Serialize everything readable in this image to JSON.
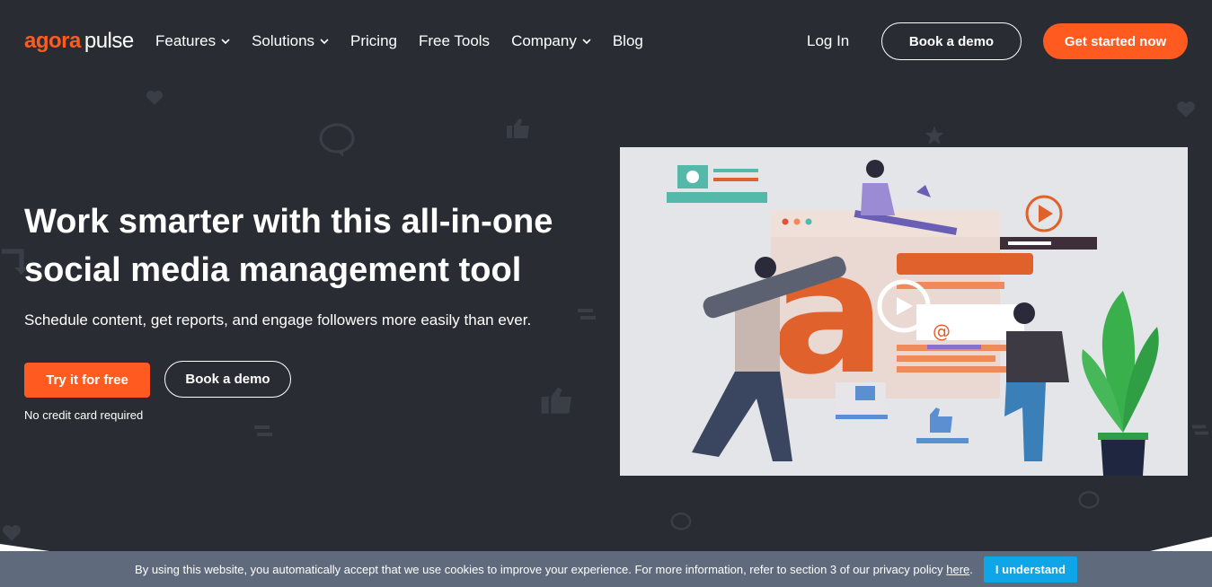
{
  "header": {
    "logo_primary": "agora",
    "logo_secondary": "pulse",
    "nav": [
      {
        "label": "Features",
        "has_dropdown": true
      },
      {
        "label": "Solutions",
        "has_dropdown": true
      },
      {
        "label": "Pricing",
        "has_dropdown": false
      },
      {
        "label": "Free Tools",
        "has_dropdown": false
      },
      {
        "label": "Company",
        "has_dropdown": true
      },
      {
        "label": "Blog",
        "has_dropdown": false
      }
    ],
    "login_label": "Log In",
    "book_demo_label": "Book a demo",
    "get_started_label": "Get started now"
  },
  "hero": {
    "title": "Work smarter with this all-in-one social media management tool",
    "subtitle": "Schedule content, get reports, and engage followers more easily than ever.",
    "try_label": "Try it for free",
    "demo_label": "Book a demo",
    "note": "No credit card required"
  },
  "video": {
    "icon": "play-icon",
    "brand_letter": "a"
  },
  "cookie": {
    "text": "By using this website, you automatically accept that we use cookies to improve your experience. For more information, refer to section 3 of our privacy policy",
    "link_label": "here",
    "punct": ".",
    "accept_label": "I understand"
  },
  "colors": {
    "background": "#292d33",
    "brand_orange": "#ff5a1f",
    "cookie_bar": "#5f6a7d",
    "cookie_button": "#0ea5e9"
  }
}
